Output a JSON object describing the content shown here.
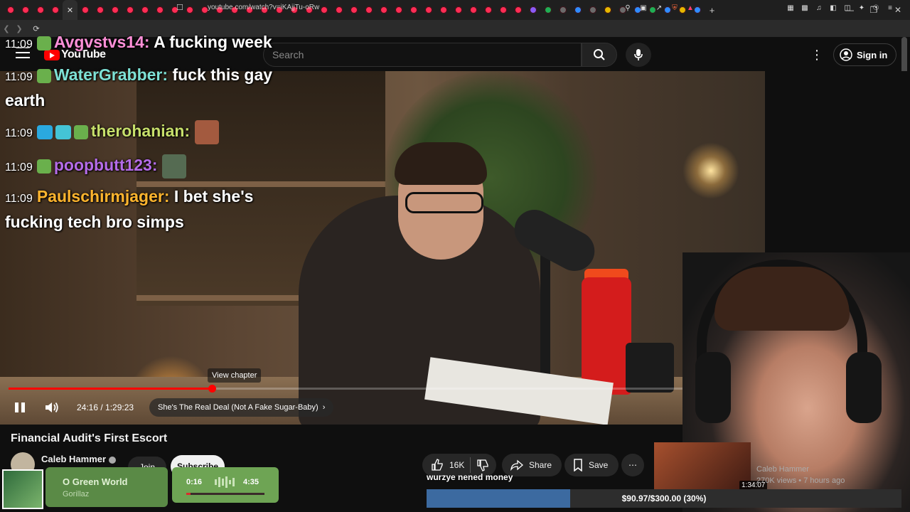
{
  "browser": {
    "url": "youtube.com/watch?v=iKAjjTu-oRw"
  },
  "youtube": {
    "logo_text": "YouTube",
    "search_placeholder": "Search",
    "signin_label": "Sign in"
  },
  "chat": [
    {
      "time": "11:09",
      "user": "Avgvstvs14:",
      "color": "#ff8fd8",
      "message": "A fucking week"
    },
    {
      "time": "11:09",
      "user": "WaterGrabber:",
      "color": "#7ee1d5",
      "message": "fuck this gay",
      "message2": "earth"
    },
    {
      "time": "11:09",
      "user": "therohanian:",
      "color": "#c7df6b",
      "message": ""
    },
    {
      "time": "11:09",
      "user": "poopbutt123:",
      "color": "#b56ce8",
      "message": ""
    },
    {
      "time": "11:09",
      "user": "Paulschirmjager:",
      "color": "#ffb52e",
      "message": "I bet she's",
      "message2": "fucking tech bro simps"
    }
  ],
  "player": {
    "chapter_tooltip": "View chapter",
    "time_current": "24:16",
    "time_total": "1:29:23",
    "time_display": "24:16 / 1:29:23",
    "chapter_title": "She's The Real Deal (Not A Fake Sugar-Baby)",
    "progress_fraction": 0.2715,
    "colors": {
      "progress": "#ff0000"
    }
  },
  "video": {
    "title": "Financial Audit's First Escort",
    "channel": "Caleb Hammer",
    "join_label": "Join",
    "subscribe_label": "Subscribe",
    "likes": "16K",
    "share_label": "Share",
    "save_label": "Save"
  },
  "related": {
    "duration": "1:34:07",
    "channel": "Caleb Hammer",
    "meta": "270K views • 7 hours ago"
  },
  "music": {
    "title": "O Green World",
    "artist": "Gorillaz",
    "elapsed": "0:16",
    "total": "4:35",
    "progress_fraction": 0.058
  },
  "overlay": {
    "caption": "wurzye nened money",
    "goal_text": "$90.97/$300.00 (30%)",
    "goal_fraction": 0.303
  }
}
